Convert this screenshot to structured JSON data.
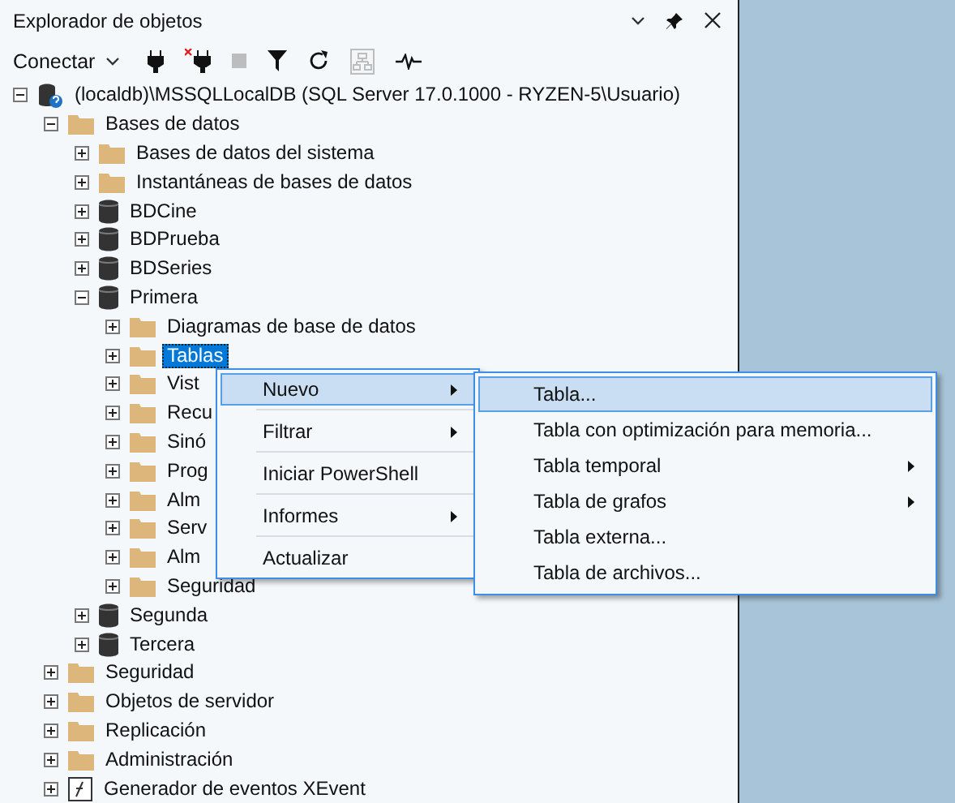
{
  "panel": {
    "title": "Explorador de objetos"
  },
  "toolbar": {
    "connect_label": "Conectar",
    "buttons": [
      {
        "kind": "connect",
        "disabled": false
      },
      {
        "kind": "disconnect",
        "disabled": false
      },
      {
        "kind": "stop",
        "disabled": true
      },
      {
        "kind": "filter",
        "disabled": false
      },
      {
        "kind": "refresh",
        "disabled": false
      },
      {
        "kind": "schema",
        "disabled": true
      },
      {
        "kind": "activity",
        "disabled": false
      }
    ]
  },
  "tree": [
    {
      "label": "(localdb)\\MSSQLLocalDB (SQL Server 17.0.1000 - RYZEN-5\\Usuario)",
      "kind": "server",
      "expanded": true,
      "selected": false,
      "children": [
        {
          "label": "Bases de datos",
          "kind": "folder",
          "expanded": true,
          "selected": false,
          "children": [
            {
              "label": "Bases de datos del sistema",
              "kind": "folder",
              "expanded": false,
              "selected": false
            },
            {
              "label": "Instantáneas de bases de datos",
              "kind": "folder",
              "expanded": false,
              "selected": false
            },
            {
              "label": "BDCine",
              "kind": "database",
              "expanded": false,
              "selected": false
            },
            {
              "label": "BDPrueba",
              "kind": "database",
              "expanded": false,
              "selected": false
            },
            {
              "label": "BDSeries",
              "kind": "database",
              "expanded": false,
              "selected": false
            },
            {
              "label": "Primera",
              "kind": "database",
              "expanded": true,
              "selected": false,
              "children": [
                {
                  "label": "Diagramas de base de datos",
                  "kind": "folder",
                  "expanded": false,
                  "selected": false
                },
                {
                  "label": "Tablas",
                  "kind": "folder",
                  "expanded": false,
                  "selected": true
                },
                {
                  "label": "Vist",
                  "kind": "folder",
                  "expanded": false,
                  "selected": false
                },
                {
                  "label": "Recu",
                  "kind": "folder",
                  "expanded": false,
                  "selected": false
                },
                {
                  "label": "Sinó",
                  "kind": "folder",
                  "expanded": false,
                  "selected": false
                },
                {
                  "label": "Prog",
                  "kind": "folder",
                  "expanded": false,
                  "selected": false
                },
                {
                  "label": "Alm",
                  "kind": "folder",
                  "expanded": false,
                  "selected": false
                },
                {
                  "label": "Serv",
                  "kind": "folder",
                  "expanded": false,
                  "selected": false
                },
                {
                  "label": "Alm",
                  "kind": "folder",
                  "expanded": false,
                  "selected": false
                },
                {
                  "label": "Seguridad",
                  "kind": "folder",
                  "expanded": false,
                  "selected": false
                }
              ]
            },
            {
              "label": "Segunda",
              "kind": "database",
              "expanded": false,
              "selected": false
            },
            {
              "label": "Tercera",
              "kind": "database",
              "expanded": false,
              "selected": false
            }
          ]
        },
        {
          "label": "Seguridad",
          "kind": "folder",
          "expanded": false,
          "selected": false
        },
        {
          "label": "Objetos de servidor",
          "kind": "folder",
          "expanded": false,
          "selected": false
        },
        {
          "label": "Replicación",
          "kind": "folder",
          "expanded": false,
          "selected": false
        },
        {
          "label": "Administración",
          "kind": "folder",
          "expanded": false,
          "selected": false
        },
        {
          "label": "Generador de eventos XEvent",
          "kind": "xevent",
          "expanded": false,
          "selected": false
        }
      ]
    }
  ],
  "context_menu": [
    {
      "label": "Nuevo",
      "selected": true,
      "submenu": true
    },
    {
      "label": "Filtrar",
      "selected": false,
      "submenu": true
    },
    {
      "label": "Iniciar PowerShell",
      "selected": false,
      "submenu": false
    },
    {
      "label": "Informes",
      "selected": false,
      "submenu": true
    },
    {
      "label": "Actualizar",
      "selected": false,
      "submenu": false
    }
  ],
  "submenu": [
    {
      "label": "Tabla...",
      "selected": true,
      "submenu": false
    },
    {
      "label": "Tabla con optimización para memoria...",
      "selected": false,
      "submenu": false
    },
    {
      "label": "Tabla temporal",
      "selected": false,
      "submenu": true
    },
    {
      "label": "Tabla de grafos",
      "selected": false,
      "submenu": true
    },
    {
      "label": "Tabla externa...",
      "selected": false,
      "submenu": false
    },
    {
      "label": "Tabla de archivos...",
      "selected": false,
      "submenu": false
    }
  ]
}
